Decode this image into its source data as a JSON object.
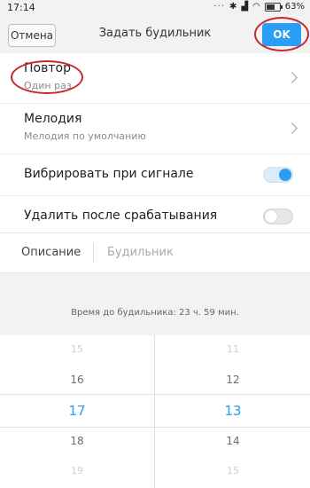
{
  "status": {
    "time": "17:14",
    "dots": "···",
    "battery": "63%",
    "battery_level": 0.63
  },
  "header": {
    "cancel": "Отмена",
    "title": "Задать будильник",
    "ok": "OK"
  },
  "repeat": {
    "label": "Повтор",
    "value": "Один раз"
  },
  "melody": {
    "label": "Мелодия",
    "value": "Мелодия по умолчанию"
  },
  "vibrate": {
    "label": "Вибрировать при сигнале",
    "on": true
  },
  "delete_after": {
    "label": "Удалить после срабатывания",
    "on": false
  },
  "description": {
    "label": "Описание",
    "placeholder": "Будильник"
  },
  "remaining": "Время до будильника: 23 ч. 59 мин.",
  "picker": {
    "hours": [
      "15",
      "16",
      "17",
      "18",
      "19"
    ],
    "minutes": [
      "11",
      "12",
      "13",
      "14",
      "15"
    ],
    "selected_hour": "17",
    "selected_minute": "13"
  },
  "colors": {
    "accent": "#2a9df4",
    "annotation": "#c62828"
  }
}
